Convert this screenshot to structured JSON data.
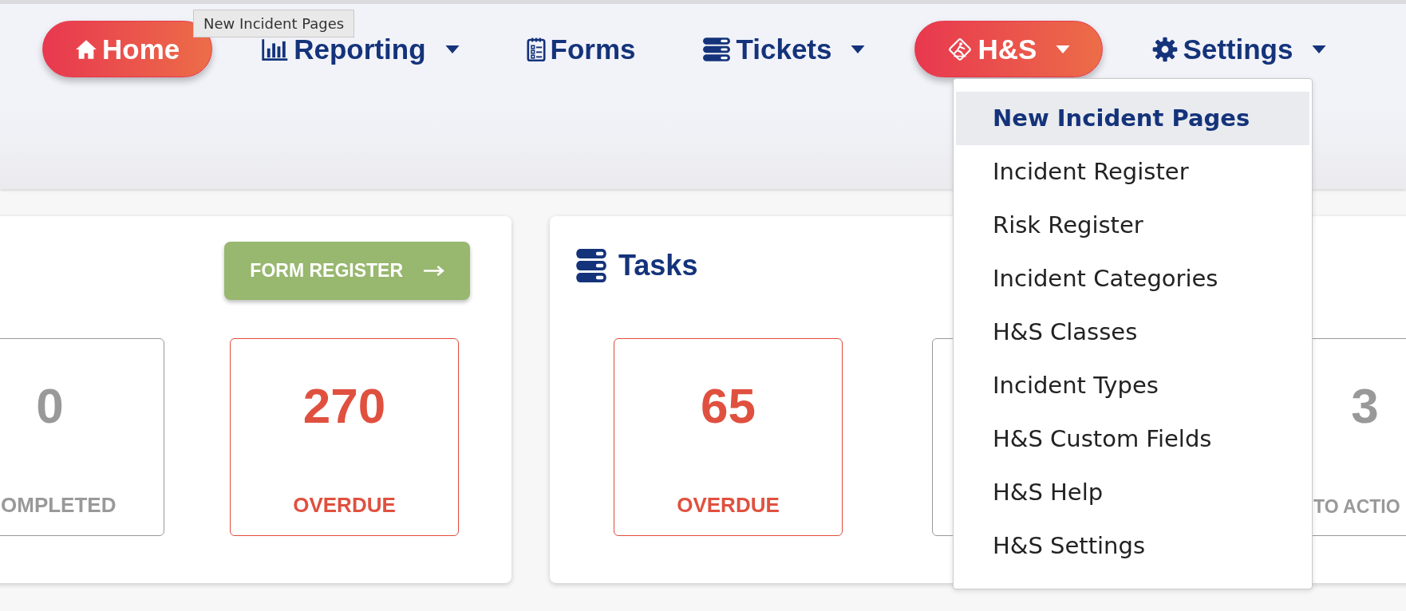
{
  "nav": [
    {
      "label": "Home",
      "kind": "home",
      "selected": true,
      "dropdown": false
    },
    {
      "label": "Reporting",
      "kind": "chart",
      "selected": false,
      "dropdown": true
    },
    {
      "label": "Forms",
      "kind": "form",
      "selected": false,
      "dropdown": false
    },
    {
      "label": "Tickets",
      "kind": "tickets",
      "selected": false,
      "dropdown": true
    },
    {
      "label": "H&S",
      "kind": "hazard",
      "selected": true,
      "dropdown": true
    },
    {
      "label": "Settings",
      "kind": "gear",
      "selected": false,
      "dropdown": true
    }
  ],
  "tooltip": {
    "text": "New Incident Pages"
  },
  "menu": {
    "items": [
      {
        "label": "New Incident Pages",
        "selected": true
      },
      {
        "label": "Incident Register",
        "selected": false
      },
      {
        "label": "Risk Register",
        "selected": false
      },
      {
        "label": "Incident Categories",
        "selected": false
      },
      {
        "label": "H&S Classes",
        "selected": false
      },
      {
        "label": "Incident Types",
        "selected": false
      },
      {
        "label": "H&S Custom Fields",
        "selected": false
      },
      {
        "label": "H&S Help",
        "selected": false
      },
      {
        "label": "H&S Settings",
        "selected": false
      }
    ]
  },
  "cards": [
    {
      "kind": "forms",
      "button": {
        "label": "FORM REGISTER"
      },
      "stats": [
        {
          "value": "0",
          "label": "OMPLETED",
          "kind": "neutral"
        },
        {
          "value": "270",
          "label": "OVERDUE",
          "kind": "alert"
        }
      ]
    },
    {
      "kind": "tasks",
      "title": "Tasks",
      "stats": [
        {
          "value": "65",
          "label": "OVERDUE",
          "kind": "alert"
        },
        {
          "kind": "neutral"
        },
        {
          "value": "3",
          "label": "TO ACTIO",
          "kind": "neutral"
        }
      ]
    }
  ]
}
